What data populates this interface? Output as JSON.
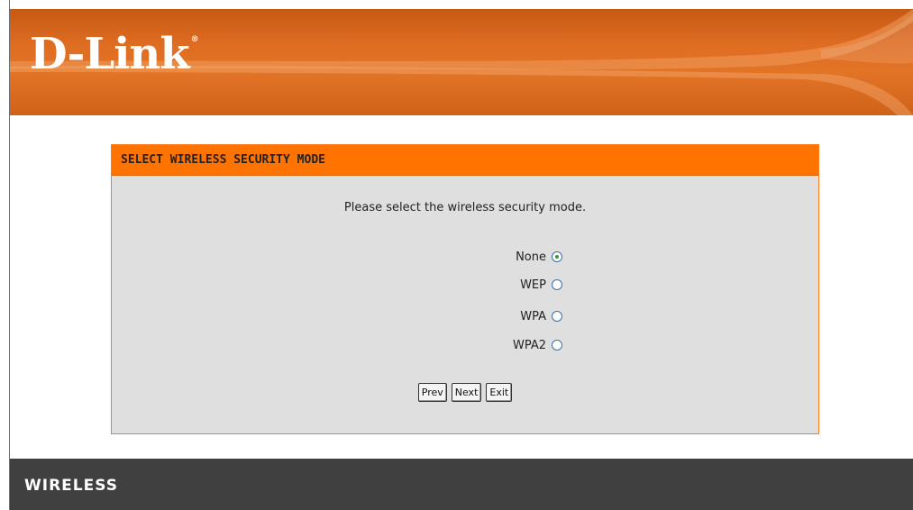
{
  "header": {
    "logo_text": "D-Link",
    "logo_mark": "®"
  },
  "panel": {
    "title": "SELECT WIRELESS SECURITY MODE",
    "prompt": "Please select the wireless security mode.",
    "options": [
      {
        "label": "None",
        "selected": true
      },
      {
        "label": "WEP",
        "selected": false
      },
      {
        "label": "WPA",
        "selected": false
      },
      {
        "label": "WPA2",
        "selected": false
      }
    ],
    "buttons": {
      "prev": "Prev",
      "next": "Next",
      "exit": "Exit"
    }
  },
  "footer": {
    "label": "WIRELESS"
  },
  "colors": {
    "header": "#e06f24",
    "panel_title": "#ff7300",
    "panel_bg": "#dfdfdf",
    "footer": "#404040"
  }
}
